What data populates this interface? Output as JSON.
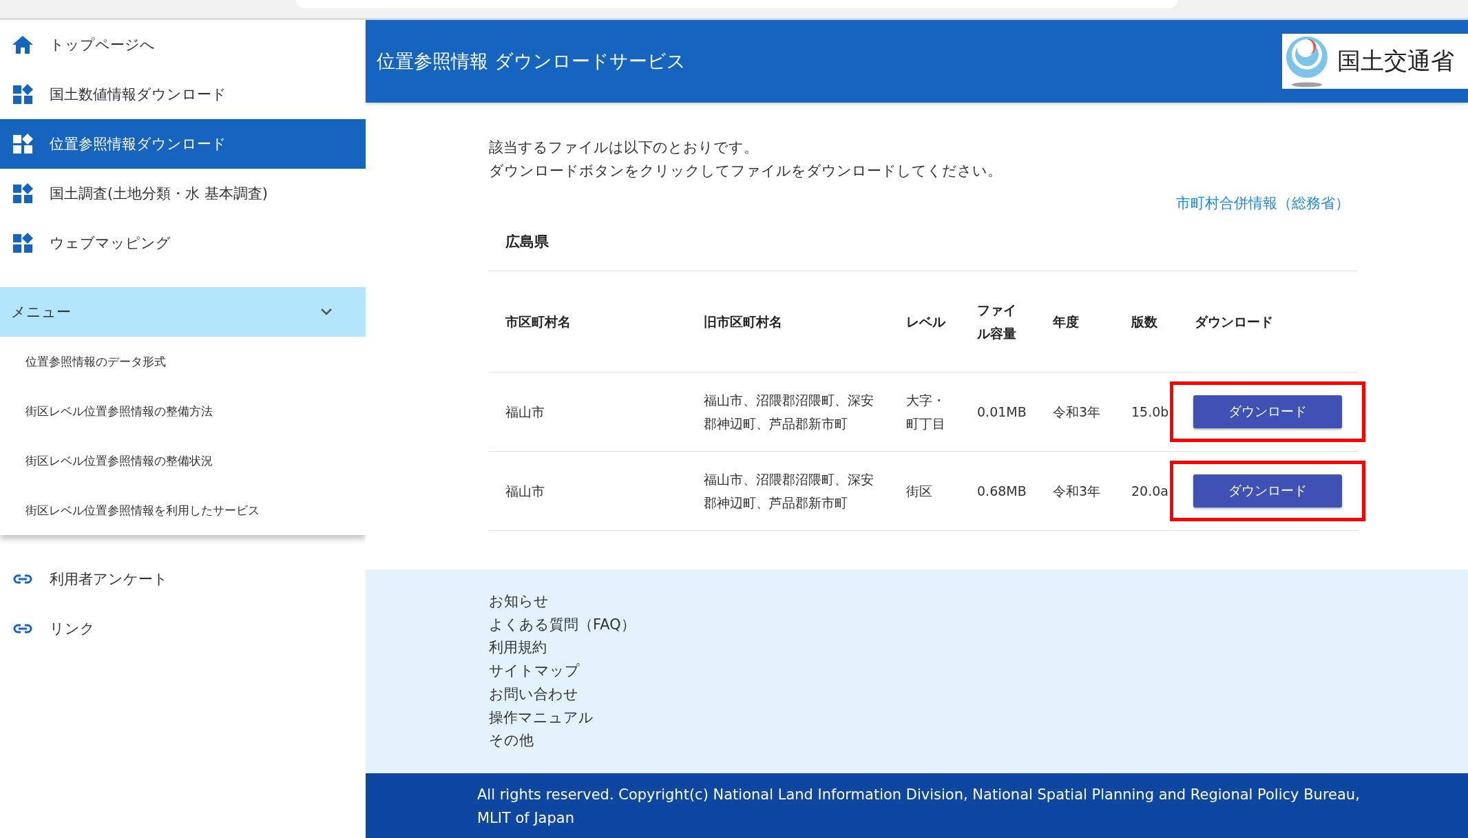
{
  "sidebar": {
    "items": [
      {
        "label": "トップページへ",
        "kind": "home",
        "selected": false
      },
      {
        "label": "国土数値情報ダウンロード",
        "kind": "service",
        "selected": false
      },
      {
        "label": "位置参照情報ダウンロード",
        "kind": "service",
        "selected": true
      },
      {
        "label": "国土調査(土地分類・水 基本調査)",
        "kind": "service",
        "selected": false
      },
      {
        "label": "ウェブマッピング",
        "kind": "service",
        "selected": false
      }
    ],
    "menu": {
      "label": "メニュー",
      "expanded": true,
      "items": [
        "位置参照情報のデータ形式",
        "街区レベル位置参照情報の整備方法",
        "街区レベル位置参照情報の整備状況",
        "街区レベル位置参照情報を利用したサービス"
      ]
    },
    "links": [
      {
        "label": "利用者アンケート"
      },
      {
        "label": "リンク"
      }
    ]
  },
  "header": {
    "title": "位置参照情報 ダウンロードサービス",
    "logo_text": "国土交通省"
  },
  "intro": [
    "該当するファイルは以下のとおりです。",
    "ダウンロードボタンをクリックしてファイルをダウンロードしてください。"
  ],
  "merger_link": "市町村合併情報（総務省）",
  "table": {
    "title": "広島県",
    "columns": [
      "市区町村名",
      "旧市区町村名",
      "レベル",
      "ファイル容量",
      "年度",
      "版数",
      "ダウンロード"
    ],
    "rows": [
      {
        "cells": [
          "福山市",
          "福山市、沼隈郡沼隈町、深安郡神辺町、芦品郡新市町",
          "大字・町丁目",
          "0.01MB",
          "令和3年",
          "15.0b"
        ],
        "button": "ダウンロード",
        "highlighted": true
      },
      {
        "cells": [
          "福山市",
          "福山市、沼隈郡沼隈町、深安郡神辺町、芦品郡新市町",
          "街区",
          "0.68MB",
          "令和3年",
          "20.0a"
        ],
        "button": "ダウンロード",
        "highlighted": true
      }
    ]
  },
  "footer": {
    "links": [
      "お知らせ",
      "よくある質問（FAQ）",
      "利用規約",
      "サイトマップ",
      "お問い合わせ",
      "操作マニュアル",
      "その他"
    ],
    "copyright": "All rights reserved. Copyright(c) National Land Information Division, National Spatial Planning and Regional Policy Bureau, MLIT of Japan"
  }
}
